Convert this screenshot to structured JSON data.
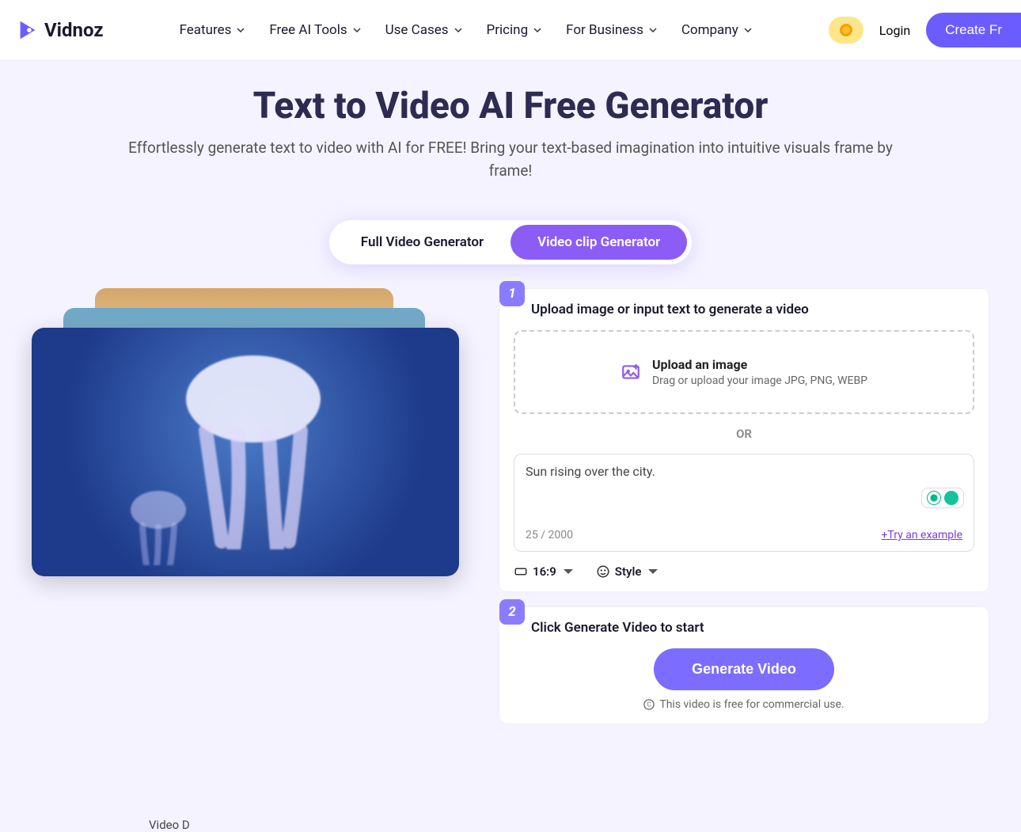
{
  "brand": "Vidnoz",
  "nav": {
    "items": [
      "Features",
      "Free AI Tools",
      "Use Cases",
      "Pricing",
      "For Business",
      "Company"
    ]
  },
  "header": {
    "login": "Login",
    "create": "Create Fr"
  },
  "hero": {
    "title": "Text to Video AI Free Generator",
    "subtitle": "Effortlessly generate text to video with AI for FREE! Bring your text-based imagination into intuitive visuals frame by frame!"
  },
  "tabs": {
    "full": "Full Video Generator",
    "clip": "Video clip Generator"
  },
  "step1": {
    "num": "1",
    "title": "Upload image or input text to generate a video",
    "upload_title": "Upload an image",
    "upload_hint": "Drag or upload your image JPG, PNG, WEBP",
    "or": "OR",
    "textarea_value": "Sun rising over the city.",
    "char_count": "25 / 2000",
    "try_example": "+Try an example",
    "ratio": "16:9",
    "style": "Style"
  },
  "step2": {
    "num": "2",
    "title": "Click Generate Video to start",
    "button": "Generate Video",
    "info": "This video is free for commercial use."
  },
  "bottom": "Video D"
}
